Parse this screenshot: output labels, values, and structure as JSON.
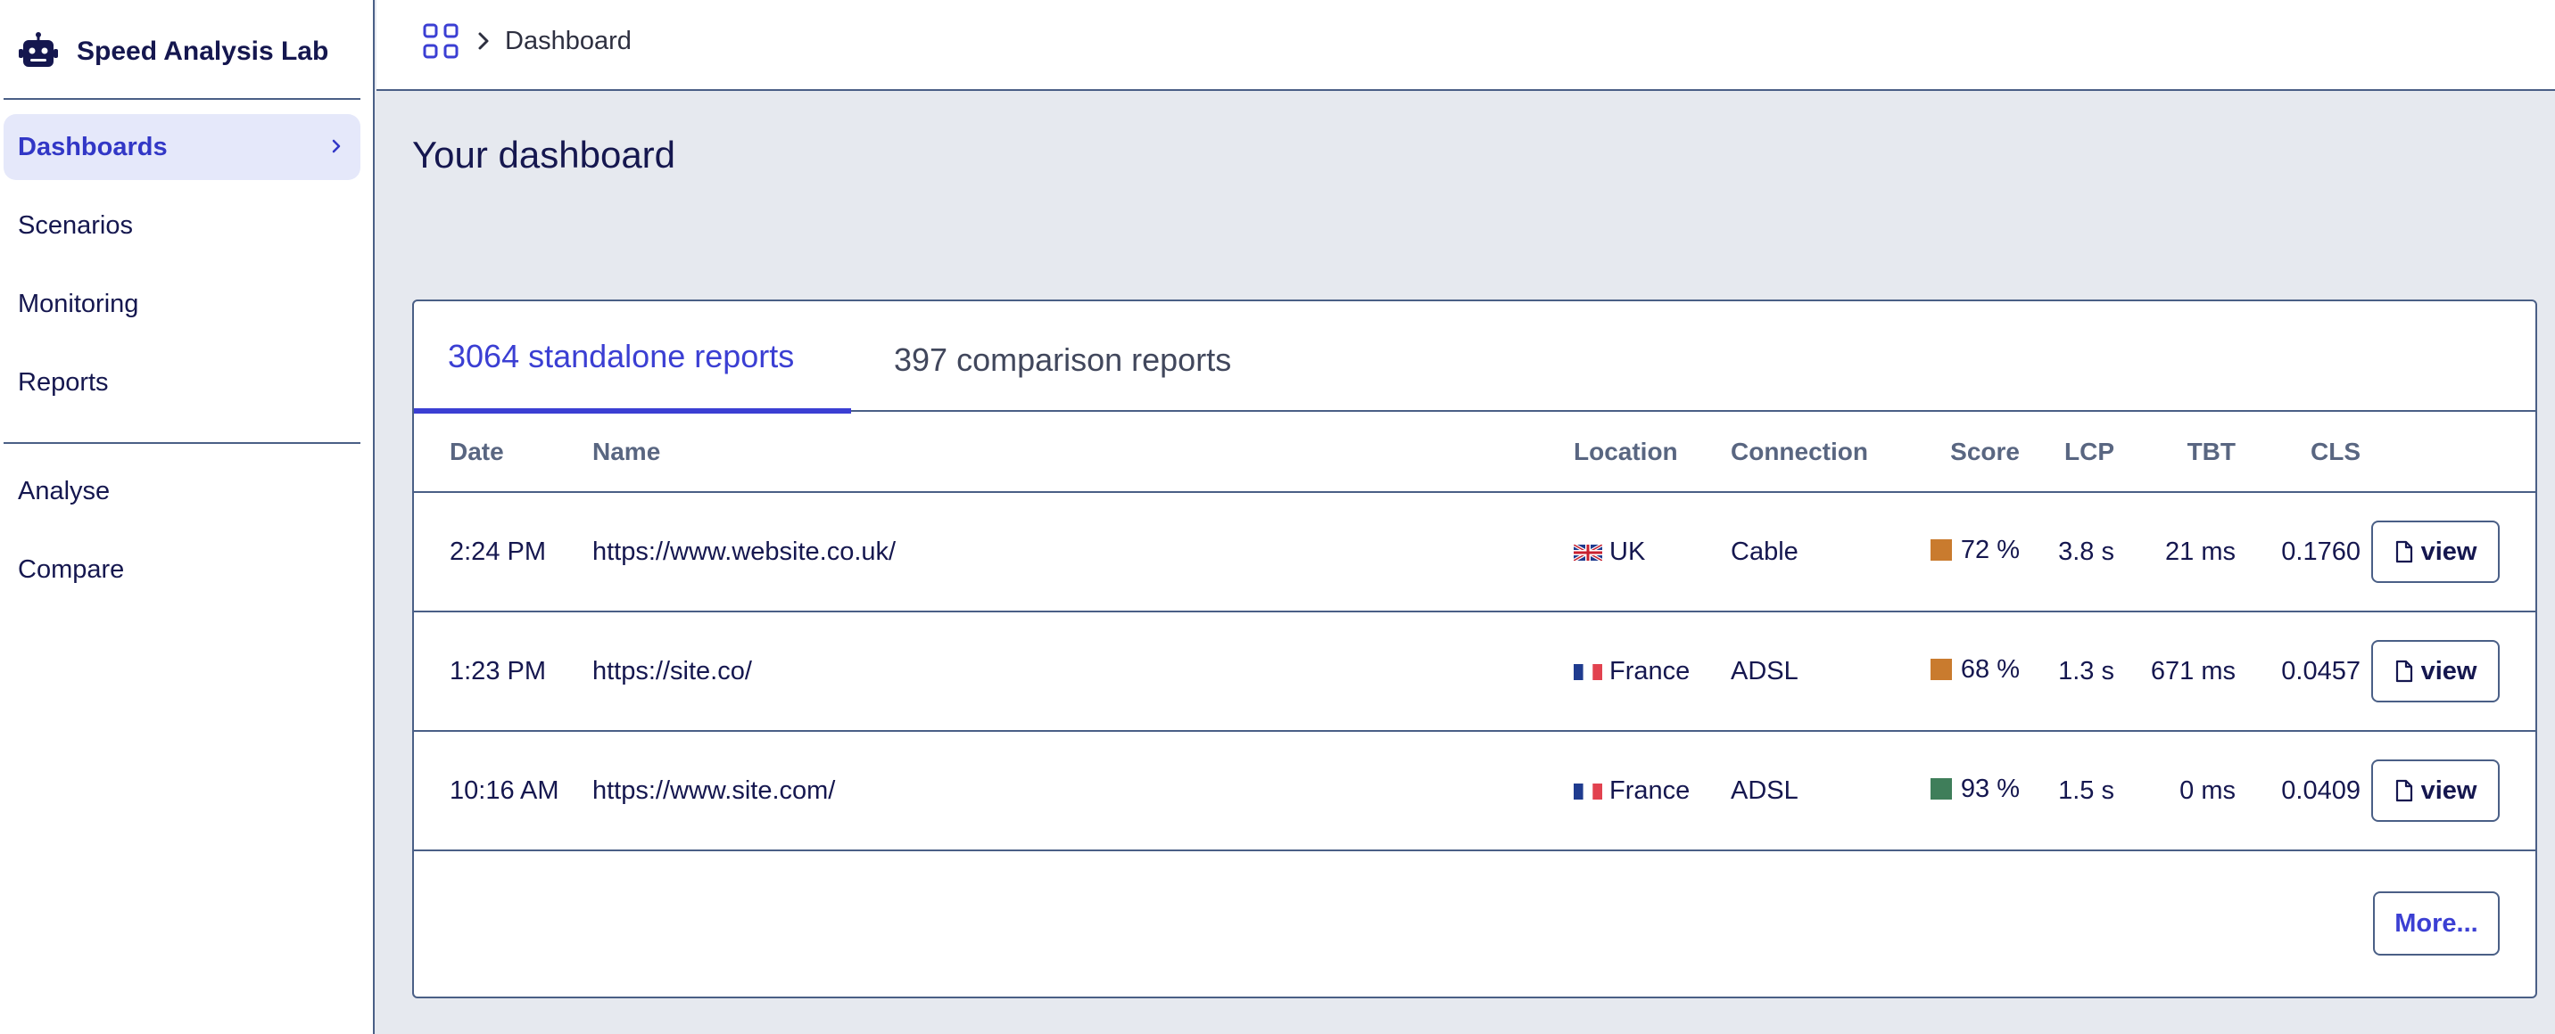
{
  "app": {
    "name": "Speed Analysis Lab"
  },
  "sidebar": {
    "items": [
      {
        "label": "Dashboards",
        "active": true
      },
      {
        "label": "Scenarios"
      },
      {
        "label": "Monitoring"
      },
      {
        "label": "Reports"
      },
      {
        "label": "Analyse"
      },
      {
        "label": "Compare"
      }
    ]
  },
  "breadcrumb": {
    "current": "Dashboard"
  },
  "page": {
    "title": "Your dashboard"
  },
  "tabs": {
    "standalone": "3064 standalone reports",
    "comparison": "397 comparison reports"
  },
  "table": {
    "headers": {
      "date": "Date",
      "name": "Name",
      "location": "Location",
      "connection": "Connection",
      "score": "Score",
      "lcp": "LCP",
      "tbt": "TBT",
      "cls": "CLS"
    },
    "rows": [
      {
        "date": "2:24 PM",
        "name": "https://www.website.co.uk/",
        "flag": "uk-flag-icon",
        "location": "UK",
        "connection": "Cable",
        "score": "72 %",
        "score_color": "#c97b2e",
        "lcp": "3.8 s",
        "tbt": "21 ms",
        "cls": "0.1760",
        "action": "view"
      },
      {
        "date": "1:23 PM",
        "name": "https://site.co/",
        "flag": "france-flag-icon",
        "location": "France",
        "connection": "ADSL",
        "score": "68 %",
        "score_color": "#c97b2e",
        "lcp": "1.3 s",
        "tbt": "671 ms",
        "cls": "0.0457",
        "action": "view"
      },
      {
        "date": "10:16 AM",
        "name": "https://www.site.com/",
        "flag": "france-flag-icon",
        "location": "France",
        "connection": "ADSL",
        "score": "93 %",
        "score_color": "#3f7e5a",
        "lcp": "1.5 s",
        "tbt": "0 ms",
        "cls": "0.0409",
        "action": "view"
      }
    ],
    "more_label": "More..."
  },
  "colors": {
    "accent": "#3b3fd3",
    "text": "#15174f",
    "border": "#4a5f86",
    "background": "#e6e9ef"
  }
}
